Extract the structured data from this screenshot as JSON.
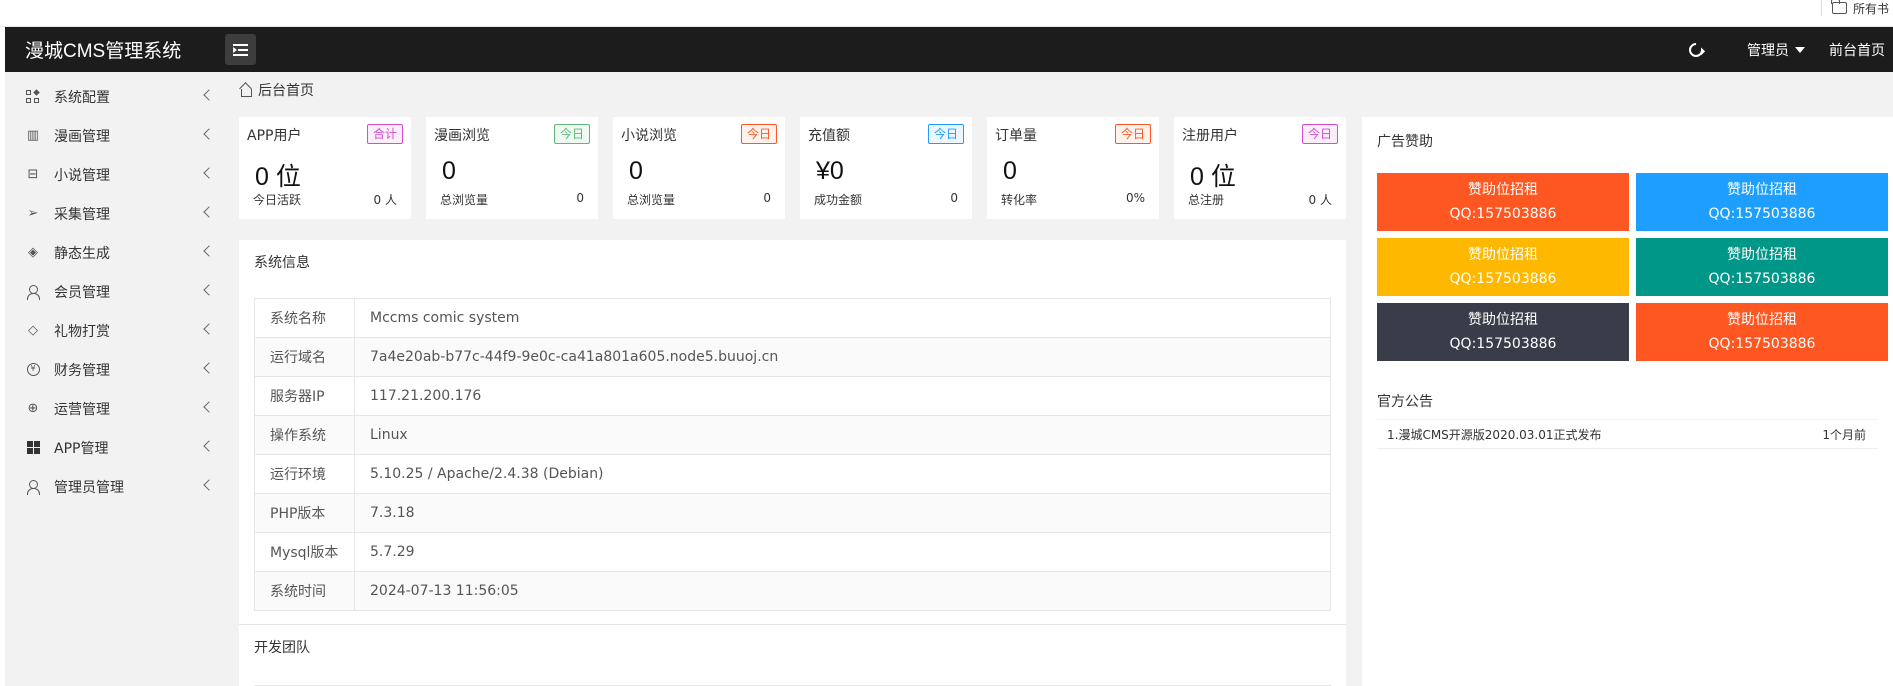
{
  "browser": {
    "bookmark_label": "所有书"
  },
  "header": {
    "brand": "漫城CMS管理系统",
    "admin_label": "管理员",
    "frontpage_label": "前台首页"
  },
  "sidebar": {
    "items": [
      {
        "label": "系统配置",
        "icon": "grid-icon"
      },
      {
        "label": "漫画管理",
        "icon": "book-icon"
      },
      {
        "label": "小说管理",
        "icon": "open-book-icon"
      },
      {
        "label": "采集管理",
        "icon": "send-icon"
      },
      {
        "label": "静态生成",
        "icon": "layers-icon"
      },
      {
        "label": "会员管理",
        "icon": "user-icon"
      },
      {
        "label": "礼物打赏",
        "icon": "diamond-icon"
      },
      {
        "label": "财务管理",
        "icon": "yen-icon"
      },
      {
        "label": "运营管理",
        "icon": "globe-icon"
      },
      {
        "label": "APP管理",
        "icon": "windows-icon"
      },
      {
        "label": "管理员管理",
        "icon": "person-icon"
      }
    ]
  },
  "breadcrumb": {
    "home": "后台首页"
  },
  "stats": [
    {
      "title": "APP用户",
      "badge": "合计",
      "badge_color": "#d24dd2",
      "value": "0 位",
      "foot_label": "今日活跃",
      "foot_value": "0 人"
    },
    {
      "title": "漫画浏览",
      "badge": "今日",
      "badge_color": "#5fb878",
      "value": "0",
      "foot_label": "总浏览量",
      "foot_value": "0"
    },
    {
      "title": "小说浏览",
      "badge": "今日",
      "badge_color": "#ff5722",
      "value": "0",
      "foot_label": "总浏览量",
      "foot_value": "0"
    },
    {
      "title": "充值额",
      "badge": "今日",
      "badge_color": "#1e9fff",
      "value": "¥0",
      "foot_label": "成功金额",
      "foot_value": "0"
    },
    {
      "title": "订单量",
      "badge": "今日",
      "badge_color": "#ff5722",
      "value": "0",
      "foot_label": "转化率",
      "foot_value": "0%"
    },
    {
      "title": "注册用户",
      "badge": "今日",
      "badge_color": "#d24dd2",
      "value": "0 位",
      "foot_label": "总注册",
      "foot_value": "0 人"
    }
  ],
  "sysinfo": {
    "title": "系统信息",
    "rows": [
      {
        "key": "系统名称",
        "value": "Mccms comic system"
      },
      {
        "key": "运行域名",
        "value": "7a4e20ab-b77c-44f9-9e0c-ca41a801a605.node5.buuoj.cn"
      },
      {
        "key": "服务器IP",
        "value": "117.21.200.176"
      },
      {
        "key": "操作系统",
        "value": "Linux"
      },
      {
        "key": "运行环境",
        "value": "5.10.25 / Apache/2.4.38 (Debian)"
      },
      {
        "key": "PHP版本",
        "value": "7.3.18"
      },
      {
        "key": "Mysql版本",
        "value": "5.7.29"
      },
      {
        "key": "系统时间",
        "value": "2024-07-13 11:56:05"
      }
    ]
  },
  "devteam": {
    "title": "开发团队"
  },
  "ads": {
    "title": "广告赞助",
    "items": [
      {
        "line1": "赞助位招租",
        "line2": "QQ:157503886",
        "color": "#ff5722"
      },
      {
        "line1": "赞助位招租",
        "line2": "QQ:157503886",
        "color": "#1e9fff"
      },
      {
        "line1": "赞助位招租",
        "line2": "QQ:157503886",
        "color": "#ffb800"
      },
      {
        "line1": "赞助位招租",
        "line2": "QQ:157503886",
        "color": "#009688"
      },
      {
        "line1": "赞助位招租",
        "line2": "QQ:157503886",
        "color": "#393d49"
      },
      {
        "line1": "赞助位招租",
        "line2": "QQ:157503886",
        "color": "#ff5722"
      }
    ]
  },
  "notices": {
    "title": "官方公告",
    "items": [
      {
        "text": "1.漫城CMS开源版2020.03.01正式发布",
        "time": "1个月前"
      }
    ]
  }
}
